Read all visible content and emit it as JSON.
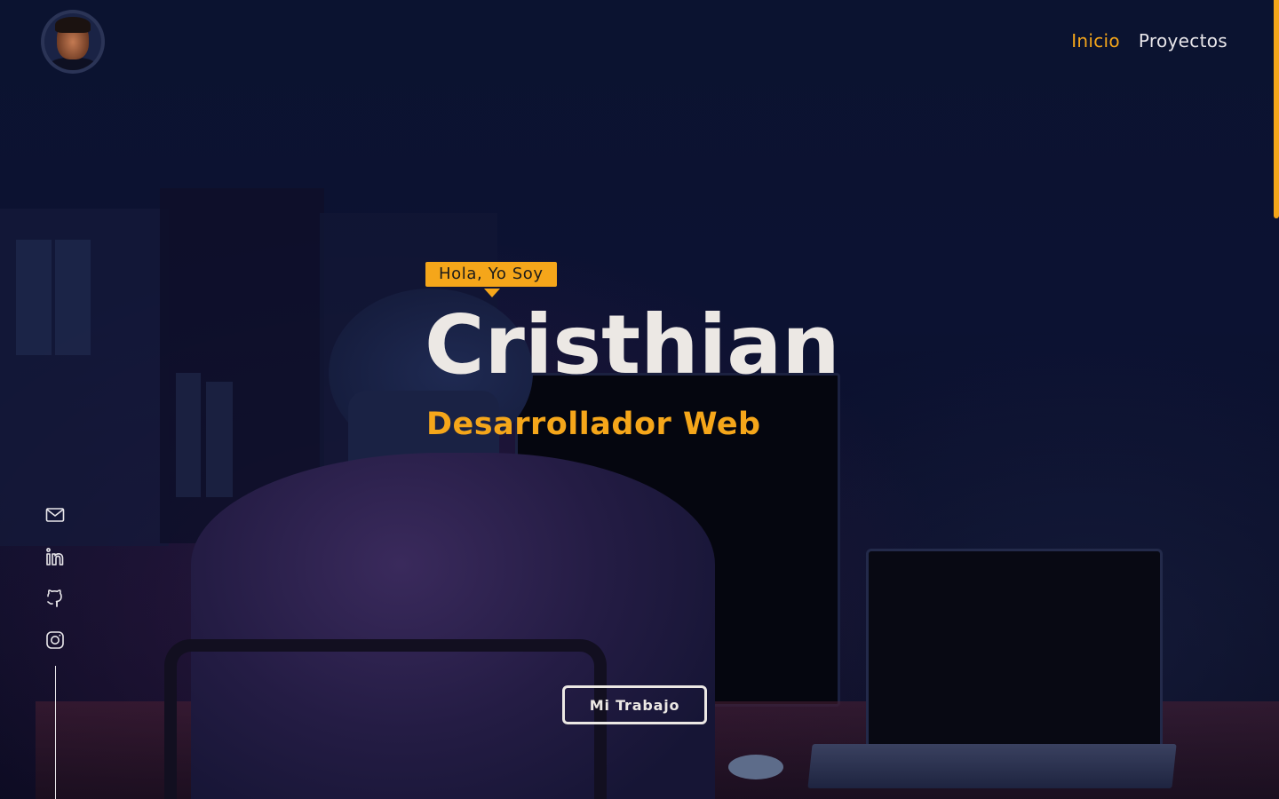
{
  "header": {
    "avatar_alt": "Cristhian",
    "nav": [
      {
        "label": "Inicio",
        "active": true
      },
      {
        "label": "Proyectos",
        "active": false
      }
    ]
  },
  "hero": {
    "greeting": "Hola, Yo Soy",
    "name": "Cristhian",
    "role": "Desarrollador Web",
    "cta_label": "Mi Trabajo"
  },
  "socials": [
    {
      "icon": "mail-icon"
    },
    {
      "icon": "linkedin-icon"
    },
    {
      "icon": "github-icon"
    },
    {
      "icon": "instagram-icon"
    }
  ],
  "colors": {
    "accent": "#f5a61a",
    "text": "#ece8e4",
    "background": "#0b1330"
  }
}
